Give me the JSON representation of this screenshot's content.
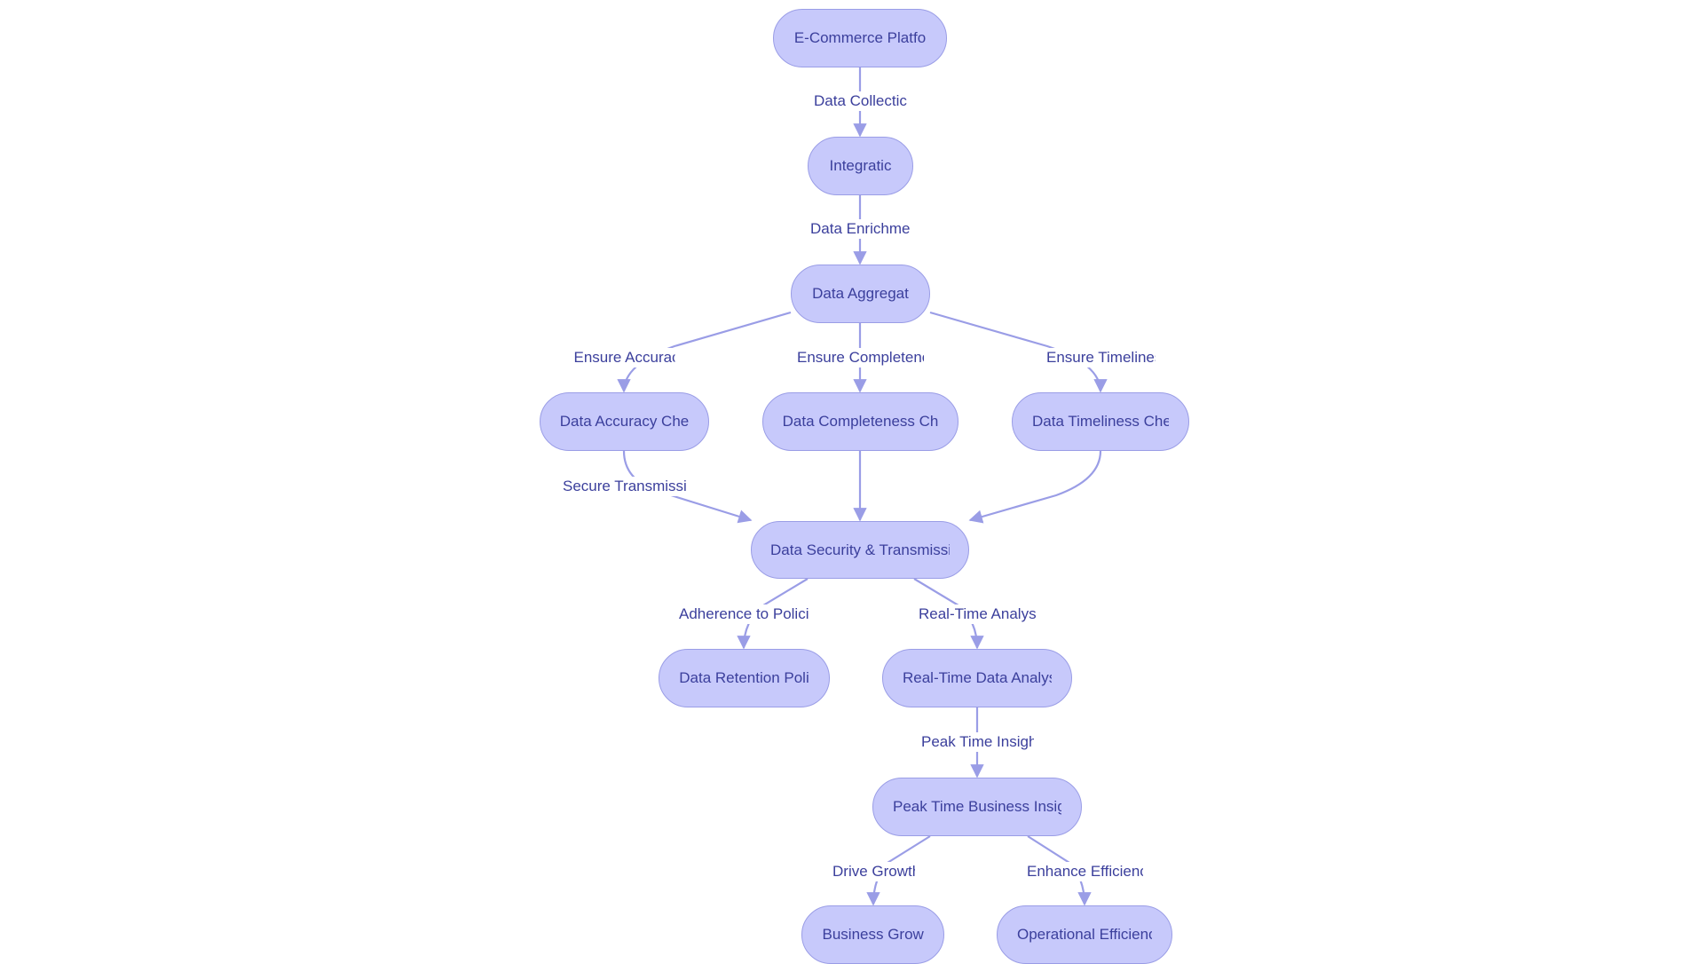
{
  "diagram": {
    "type": "flowchart",
    "direction": "top-down",
    "colors": {
      "node_fill": "#c7c9fb",
      "node_border": "#9a9de6",
      "edge": "#9a9de6",
      "text": "#3b3f9c",
      "background": "#ffffff"
    },
    "nodes": [
      {
        "id": "ecommerce",
        "label": "E-Commerce Platform",
        "visible_label": "E-Commerce Platfo"
      },
      {
        "id": "integration",
        "label": "Integration",
        "visible_label": "Integratic"
      },
      {
        "id": "aggregation",
        "label": "Data Aggregation",
        "visible_label": "Data Aggregat"
      },
      {
        "id": "accuracy",
        "label": "Data Accuracy Check",
        "visible_label": "Data Accuracy Che"
      },
      {
        "id": "completeness",
        "label": "Data Completeness Check",
        "visible_label": "Data Completeness Ch"
      },
      {
        "id": "timeliness",
        "label": "Data Timeliness Check",
        "visible_label": "Data Timeliness Che"
      },
      {
        "id": "security",
        "label": "Data Security & Transmission",
        "visible_label": "Data Security & Transmissi"
      },
      {
        "id": "retention",
        "label": "Data Retention Policies",
        "visible_label": "Data Retention Poli"
      },
      {
        "id": "realtime",
        "label": "Real-Time Data Analysis",
        "visible_label": "Real-Time Data Analys"
      },
      {
        "id": "peak",
        "label": "Peak Time Business Insights",
        "visible_label": "Peak Time Business Insigh"
      },
      {
        "id": "growth",
        "label": "Business Growth",
        "visible_label": "Business Growt"
      },
      {
        "id": "efficiency",
        "label": "Operational Efficiency",
        "visible_label": "Operational Efficienc"
      }
    ],
    "edges": [
      {
        "from": "ecommerce",
        "to": "integration",
        "label": "Data Collectic"
      },
      {
        "from": "integration",
        "to": "aggregation",
        "label": "Data Enrichmer"
      },
      {
        "from": "aggregation",
        "to": "accuracy",
        "label": "Ensure Accurac"
      },
      {
        "from": "aggregation",
        "to": "completeness",
        "label": "Ensure Completene"
      },
      {
        "from": "aggregation",
        "to": "timeliness",
        "label": "Ensure Timelines"
      },
      {
        "from": "accuracy",
        "to": "security",
        "label": "Secure Transmissi"
      },
      {
        "from": "completeness",
        "to": "security",
        "label": ""
      },
      {
        "from": "timeliness",
        "to": "security",
        "label": ""
      },
      {
        "from": "security",
        "to": "retention",
        "label": "Adherence to Polici"
      },
      {
        "from": "security",
        "to": "realtime",
        "label": "Real-Time Analysi"
      },
      {
        "from": "realtime",
        "to": "peak",
        "label": "Peak Time Insigh"
      },
      {
        "from": "peak",
        "to": "growth",
        "label": "Drive Growth"
      },
      {
        "from": "peak",
        "to": "efficiency",
        "label": "Enhance Efficienc"
      }
    ]
  }
}
